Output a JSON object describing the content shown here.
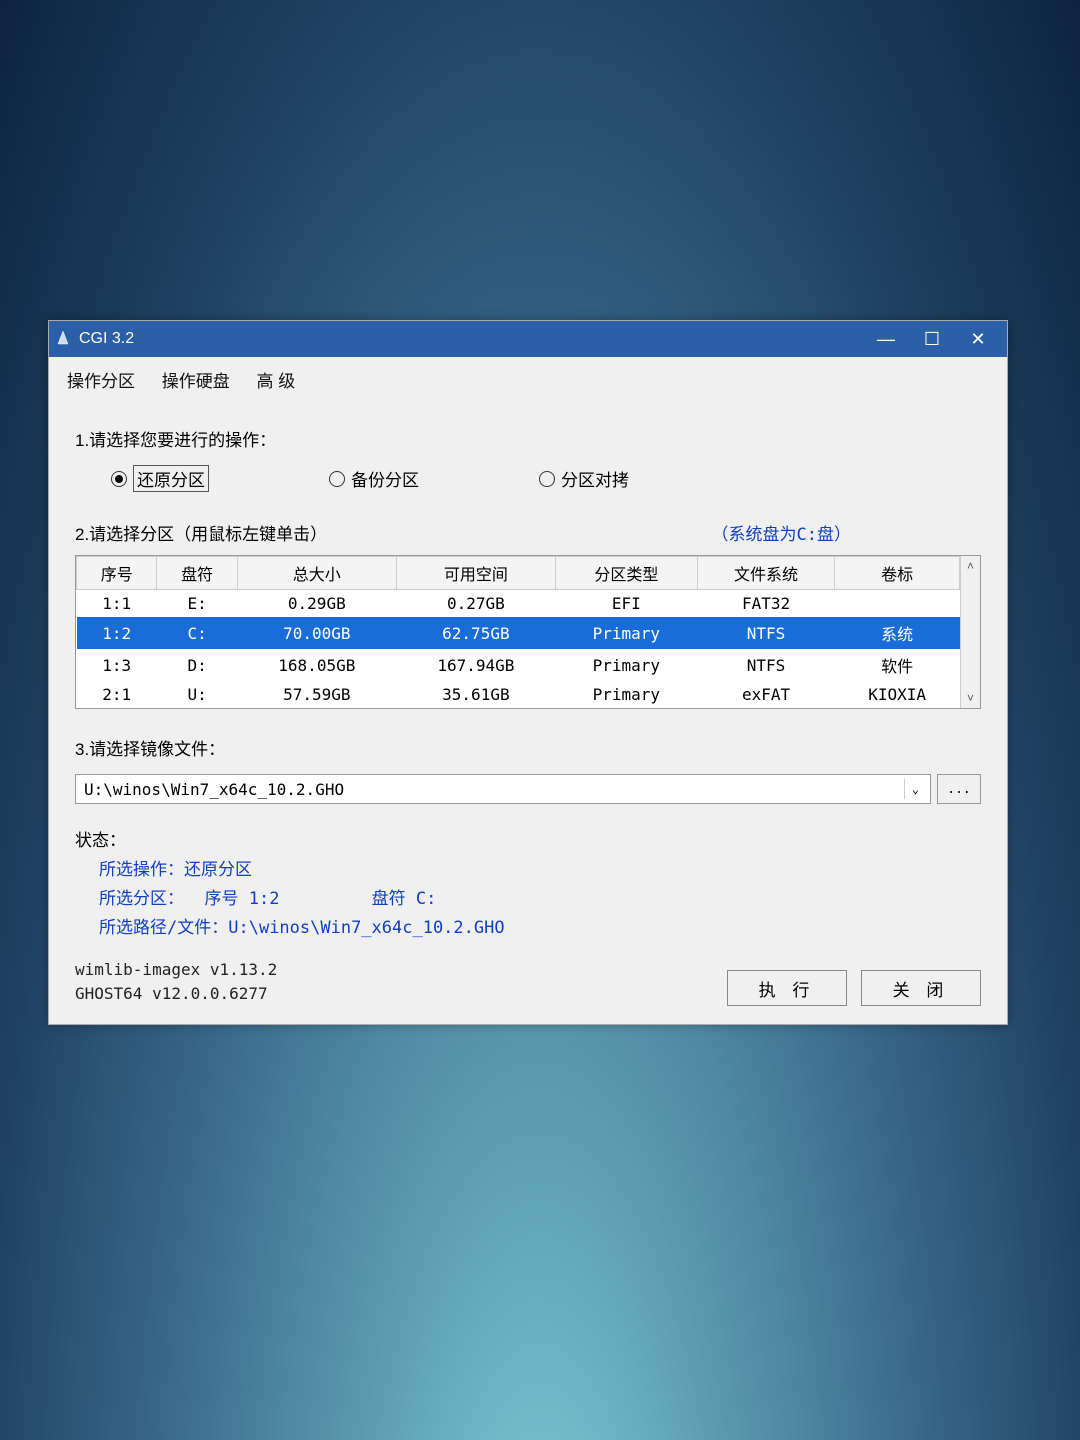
{
  "window": {
    "title": "CGI 3.2"
  },
  "menu": {
    "partition": "操作分区",
    "disk": "操作硬盘",
    "advanced": "高 级"
  },
  "step1": {
    "label": "1.请选择您要进行的操作：",
    "options": {
      "restore": "还原分区",
      "backup": "备份分区",
      "clone": "分区对拷"
    }
  },
  "step2": {
    "label": "2.请选择分区（用鼠标左键单击）",
    "hint": "（系统盘为C:盘）",
    "headers": {
      "index": "序号",
      "drive": "盘符",
      "total": "总大小",
      "free": "可用空间",
      "ptype": "分区类型",
      "fs": "文件系统",
      "vol": "卷标"
    },
    "rows": [
      {
        "index": "1:1",
        "drive": "E:",
        "total": "0.29GB",
        "free": "0.27GB",
        "ptype": "EFI",
        "fs": "FAT32",
        "vol": ""
      },
      {
        "index": "1:2",
        "drive": "C:",
        "total": "70.00GB",
        "free": "62.75GB",
        "ptype": "Primary",
        "fs": "NTFS",
        "vol": "系统"
      },
      {
        "index": "1:3",
        "drive": "D:",
        "total": "168.05GB",
        "free": "167.94GB",
        "ptype": "Primary",
        "fs": "NTFS",
        "vol": "软件"
      },
      {
        "index": "2:1",
        "drive": "U:",
        "total": "57.59GB",
        "free": "35.61GB",
        "ptype": "Primary",
        "fs": "exFAT",
        "vol": "KIOXIA"
      }
    ],
    "selected_index": 1
  },
  "step3": {
    "label": "3.请选择镜像文件：",
    "value": "U:\\winos\\Win7_x64c_10.2.GHO",
    "browse": "..."
  },
  "status": {
    "label": "状态：",
    "op_label": "所选操作：",
    "op_value": "还原分区",
    "part_label": "所选分区：",
    "part_index_label": "序号",
    "part_index_value": "1:2",
    "part_drive_label": "盘符",
    "part_drive_value": "C:",
    "path_label": "所选路径/文件：",
    "path_value": "U:\\winos\\Win7_x64c_10.2.GHO"
  },
  "versions": {
    "wimlib": "wimlib-imagex v1.13.2",
    "ghost": "GHOST64 v12.0.0.6277"
  },
  "buttons": {
    "execute": "执 行",
    "close": "关 闭"
  }
}
